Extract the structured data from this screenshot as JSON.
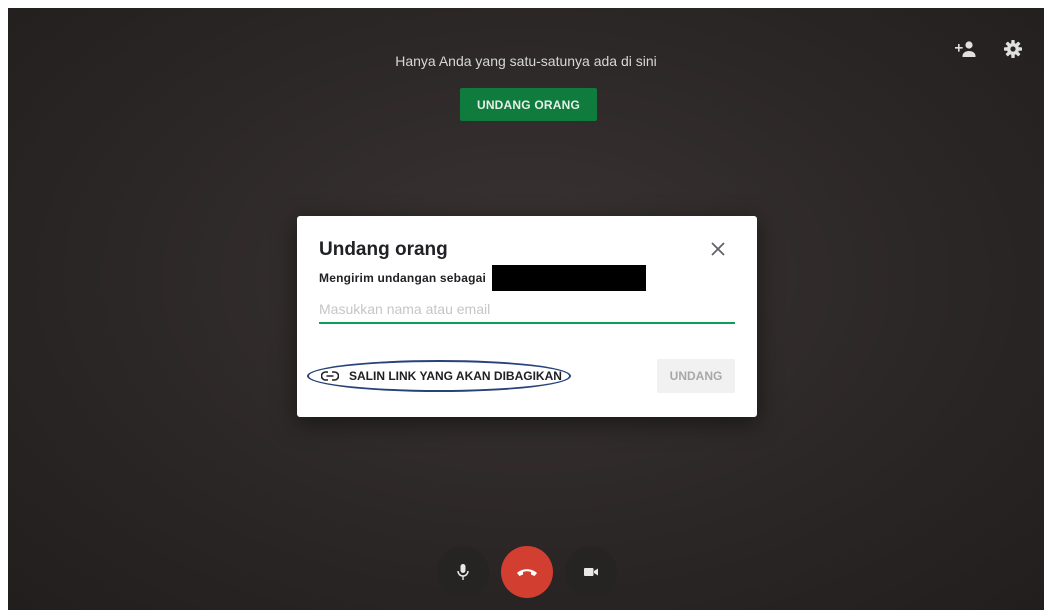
{
  "meeting": {
    "alone_message": "Hanya Anda yang satu-satunya ada di sini",
    "invite_button": "UNDANG ORANG"
  },
  "top_icons": [
    "add-person-icon",
    "gear-icon"
  ],
  "dialog": {
    "title": "Undang orang",
    "sender_label": "Mengirim undangan sebagai",
    "input_placeholder": "Masukkan nama atau email",
    "input_value": "",
    "copy_link_label": "SALIN LINK YANG AKAN DIBAGIKAN",
    "send_label": "UNDANG"
  },
  "controls": [
    "microphone-icon",
    "end-call-icon",
    "camera-icon"
  ],
  "colors": {
    "accent_green": "#0f7b3c",
    "input_underline": "#0f9d58",
    "end_call_red": "#d23f31",
    "highlight_outline": "#27437a"
  }
}
